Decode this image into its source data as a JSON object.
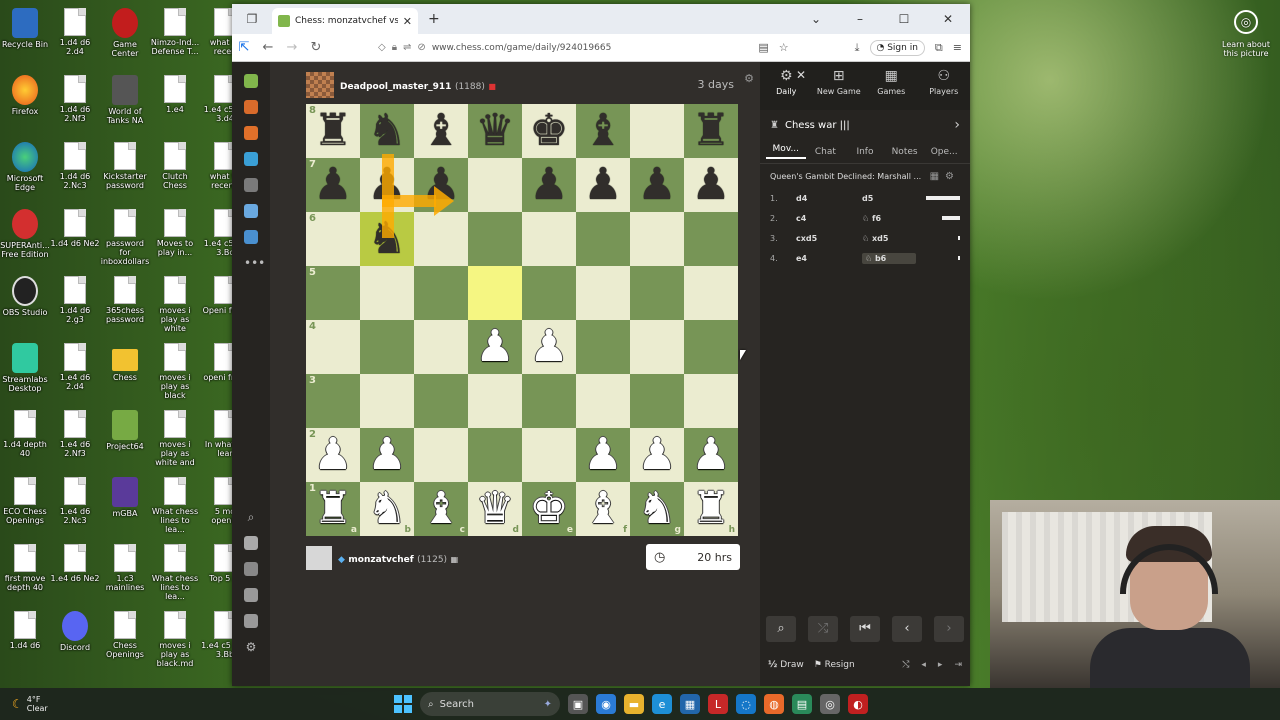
{
  "desktop": {
    "icons": [
      {
        "label": "Recycle Bin",
        "kind": "bin"
      },
      {
        "label": "1.d4 d6 2.d4",
        "kind": "file"
      },
      {
        "label": "Game Center",
        "kind": "app"
      },
      {
        "label": "Nimzo-Ind... Defense T...",
        "kind": "file"
      },
      {
        "label": "what to recen",
        "kind": "file"
      },
      {
        "label": "Firefox",
        "kind": "firefox"
      },
      {
        "label": "1.d4 d6 2.Nf3",
        "kind": "file"
      },
      {
        "label": "World of Tanks NA",
        "kind": "tank"
      },
      {
        "label": "1.e4",
        "kind": "file"
      },
      {
        "label": "1.e4 c5 d6 3.d4",
        "kind": "file"
      },
      {
        "label": "Microsoft Edge",
        "kind": "edge"
      },
      {
        "label": "1.d4 d6 2.Nc3",
        "kind": "file"
      },
      {
        "label": "Kickstarter password",
        "kind": "file"
      },
      {
        "label": "Clutch Chess",
        "kind": "file"
      },
      {
        "label": "what to recenti",
        "kind": "file"
      },
      {
        "label": "SUPERAnti... Free Edition",
        "kind": "anti"
      },
      {
        "label": "1.d4 d6 Ne2",
        "kind": "file"
      },
      {
        "label": "password for inboxdollars",
        "kind": "file"
      },
      {
        "label": "Moves to play in...",
        "kind": "file"
      },
      {
        "label": "1.e4 c5 d6 3.Bc",
        "kind": "file"
      },
      {
        "label": "OBS Studio",
        "kind": "obs"
      },
      {
        "label": "1.d4 d6 2.g3",
        "kind": "file"
      },
      {
        "label": "365chess password",
        "kind": "file"
      },
      {
        "label": "moves i play as white",
        "kind": "file"
      },
      {
        "label": "Openi from",
        "kind": "file"
      },
      {
        "label": "Streamlabs Desktop",
        "kind": "streamlabs"
      },
      {
        "label": "1.e4 d6 2.d4",
        "kind": "file"
      },
      {
        "label": "Chess",
        "kind": "folder"
      },
      {
        "label": "moves i play as black",
        "kind": "file"
      },
      {
        "label": "openi from",
        "kind": "file"
      },
      {
        "label": "1.d4 depth 40",
        "kind": "file"
      },
      {
        "label": "1.e4 d6 2.Nf3",
        "kind": "file"
      },
      {
        "label": "Project64",
        "kind": "p64"
      },
      {
        "label": "moves i play as white and",
        "kind": "file"
      },
      {
        "label": "In what to lear",
        "kind": "file"
      },
      {
        "label": "ECO Chess Openings",
        "kind": "file"
      },
      {
        "label": "1.e4 d6 2.Nc3",
        "kind": "file"
      },
      {
        "label": "mGBA",
        "kind": "mgba"
      },
      {
        "label": "What chess lines to lea...",
        "kind": "file"
      },
      {
        "label": "5 mo openin",
        "kind": "file"
      },
      {
        "label": "first move depth 40",
        "kind": "file"
      },
      {
        "label": "1.e4 d6 Ne2",
        "kind": "file"
      },
      {
        "label": "1.c3 mainlines",
        "kind": "file"
      },
      {
        "label": "What chess lines to lea...",
        "kind": "file"
      },
      {
        "label": "Top 5 m",
        "kind": "file"
      },
      {
        "label": "1.d4 d6",
        "kind": "file"
      },
      {
        "label": "Discord",
        "kind": "discord"
      },
      {
        "label": "Chess Openings",
        "kind": "file"
      },
      {
        "label": "moves i play as black.md",
        "kind": "file"
      },
      {
        "label": "1.e4 c5 Nc6 3.Bb",
        "kind": "file"
      }
    ],
    "learn_label": "Learn about this picture"
  },
  "browser": {
    "tab_title": "Chess: monzatvchef vs Deadpo",
    "url": "www.chess.com/game/daily/924019665",
    "signin_label": "Sign in"
  },
  "game": {
    "top_player": {
      "name": "Deadpool_master_911",
      "rating": "(1188)"
    },
    "bottom_player": {
      "name": "monzatvchef",
      "rating": "(1125)"
    },
    "time_left_label": "3 days",
    "clock": "20 hrs",
    "board": [
      [
        "r",
        "n",
        "b",
        "q",
        "k",
        "b",
        "",
        "r"
      ],
      [
        "p",
        "p",
        "p",
        "",
        "p",
        "p",
        "p",
        "p"
      ],
      [
        "",
        "n",
        "",
        "",
        "",
        "",
        "",
        ""
      ],
      [
        "",
        "",
        "",
        "",
        "",
        "",
        "",
        ""
      ],
      [
        "",
        "",
        "",
        "P",
        "P",
        "",
        "",
        ""
      ],
      [
        "",
        "",
        "",
        "",
        "",
        "",
        "",
        ""
      ],
      [
        "P",
        "P",
        "",
        "",
        "",
        "P",
        "P",
        "P"
      ],
      [
        "R",
        "N",
        "B",
        "Q",
        "K",
        "B",
        "N",
        "R"
      ]
    ],
    "highlight": [
      "b6",
      "d5"
    ],
    "ranks": [
      "8",
      "7",
      "6",
      "5",
      "4",
      "3",
      "2",
      "1"
    ],
    "files": [
      "a",
      "b",
      "c",
      "d",
      "e",
      "f",
      "g",
      "h"
    ]
  },
  "panel": {
    "top_tabs": [
      {
        "label": "Daily",
        "icon": "gear-icon"
      },
      {
        "label": "New Game",
        "icon": "plus-icon"
      },
      {
        "label": "Games",
        "icon": "grid-icon"
      },
      {
        "label": "Players",
        "icon": "players-icon"
      }
    ],
    "game_title": "Chess war |||",
    "sub_tabs": [
      "Mov...",
      "Chat",
      "Info",
      "Notes",
      "Ope..."
    ],
    "opening": "Queen's Gambit Declined: Marshall ...",
    "moves": [
      {
        "num": "1.",
        "white": "d4",
        "black": "d5"
      },
      {
        "num": "2.",
        "white": "c4",
        "black": "♘ f6"
      },
      {
        "num": "3.",
        "white": "cxd5",
        "black": "♘ xd5"
      },
      {
        "num": "4.",
        "white": "e4",
        "black": "♘ b6"
      }
    ],
    "draw_label": "Draw",
    "resign_label": "Resign"
  },
  "taskbar": {
    "temp": "4°F",
    "weather": "Clear",
    "search_placeholder": "Search"
  }
}
